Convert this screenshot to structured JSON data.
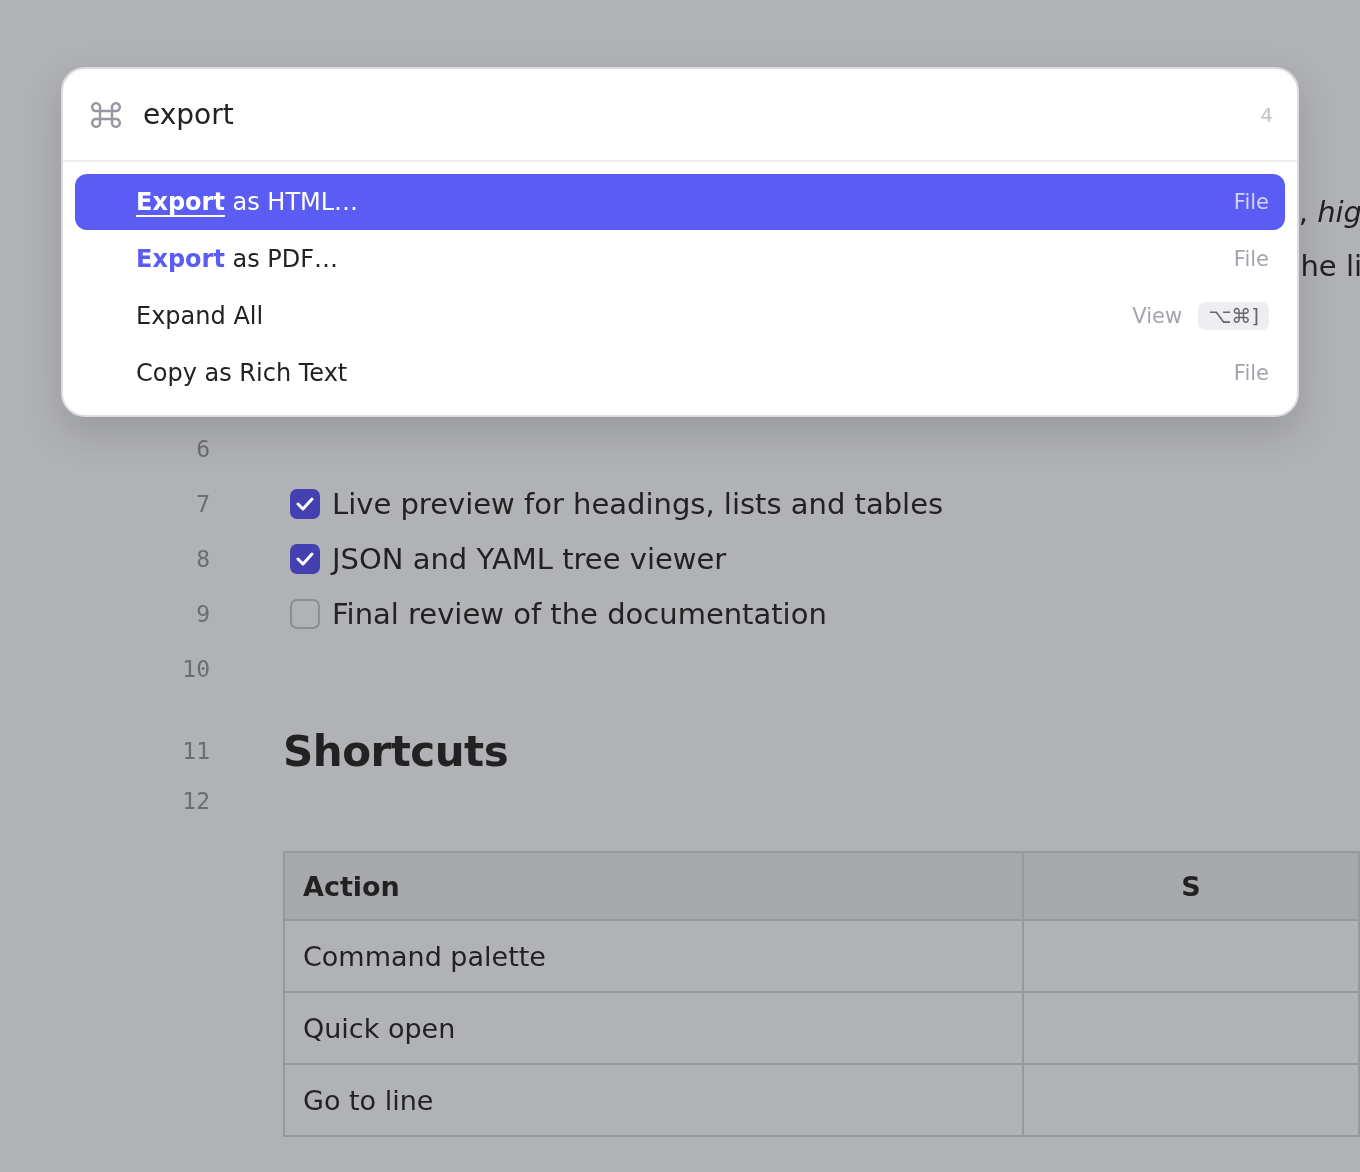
{
  "editor": {
    "overlapped_lines": [
      "**,** *hig*",
      "he li"
    ],
    "lines": [
      {
        "number": "6",
        "kind": "blank"
      },
      {
        "number": "7",
        "kind": "task",
        "checked": true,
        "text": "Live preview for headings, lists and tables"
      },
      {
        "number": "8",
        "kind": "task",
        "checked": true,
        "text": "JSON and YAML tree viewer"
      },
      {
        "number": "9",
        "kind": "task",
        "checked": false,
        "text": "Final review of the documentation"
      },
      {
        "number": "10",
        "kind": "blank"
      },
      {
        "number": "11",
        "kind": "heading",
        "text": "Shortcuts"
      },
      {
        "number": "12",
        "kind": "blank"
      }
    ],
    "table": {
      "columns": [
        "Action",
        "S"
      ],
      "rows": [
        [
          "Command palette"
        ],
        [
          "Quick open"
        ],
        [
          "Go to line"
        ]
      ]
    }
  },
  "palette": {
    "query": "export",
    "count": "4",
    "results": [
      {
        "label": "**Export** as HTML…",
        "category": "File",
        "selected": true
      },
      {
        "label": "**Export** as PDF…",
        "category": "File",
        "selected": false
      },
      {
        "label": "Expand All",
        "category": "View",
        "shortcut": "⌥⌘]",
        "selected": false
      },
      {
        "label": "Copy as Rich Text",
        "category": "File",
        "selected": false
      }
    ]
  }
}
